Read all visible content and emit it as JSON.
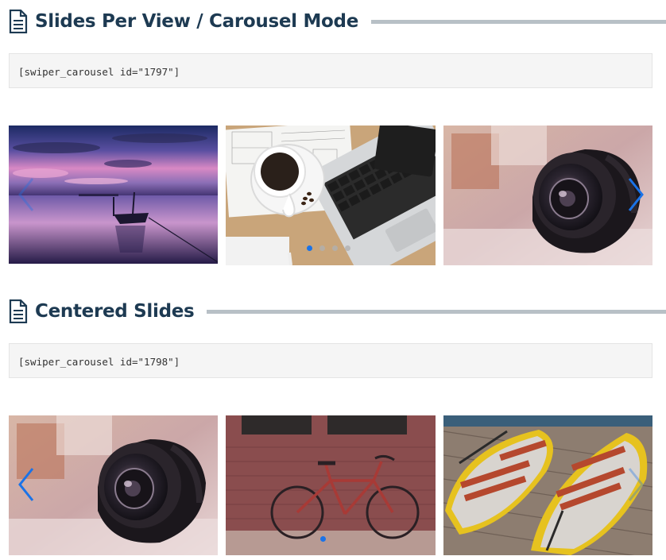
{
  "section1": {
    "title": "Slides Per View / Carousel Mode",
    "shortcode": "[swiper_carousel id=\"1797\"]",
    "slides": [
      "sunset-lake-boat-photo",
      "coffee-laptop-desk-photo",
      "camera-lens-photo"
    ],
    "pagination": {
      "count": 4,
      "active": 1
    }
  },
  "section2": {
    "title": "Centered Slides",
    "shortcode": "[swiper_carousel id=\"1798\"]",
    "slides": [
      "camera-lens-photo",
      "red-bicycle-brick-wall-photo",
      "rowboats-dock-photo"
    ],
    "pagination": {
      "count": 1,
      "active": 1
    }
  },
  "icons": {
    "heading": "document-icon",
    "prev": "chevron-left-icon",
    "next": "chevron-right-icon"
  },
  "colors": {
    "heading": "#1d3a52",
    "rule": "#b8c0c6",
    "accent": "#1a73e8",
    "code_bg": "#f5f5f5"
  }
}
